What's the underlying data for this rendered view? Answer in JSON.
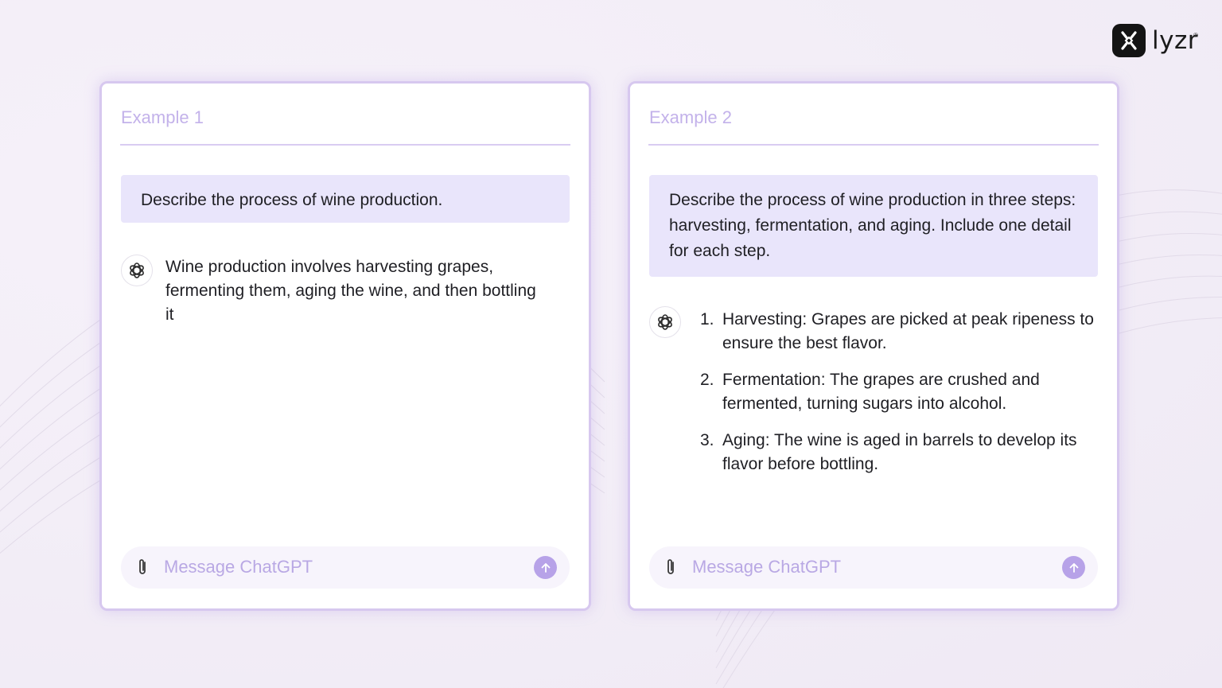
{
  "brand": {
    "name": "lyzr",
    "trademark": "®"
  },
  "examples": [
    {
      "title": "Example 1",
      "prompt": "Describe the process of wine production.",
      "reply": "Wine production involves harvesting grapes, fermenting them, aging the wine, and then bottling it",
      "composer": {
        "placeholder": "Message ChatGPT"
      }
    },
    {
      "title": "Example 2",
      "prompt": "Describe the process of wine production in three steps: harvesting, fermentation, and aging. Include one detail for each step.",
      "reply_items": [
        {
          "num": "1.",
          "text": "Harvesting: Grapes are picked at peak ripeness to ensure the best flavor."
        },
        {
          "num": "2.",
          "text": "Fermentation: The grapes are crushed and fermented, turning sugars into alcohol."
        },
        {
          "num": "3.",
          "text": "Aging: The wine is aged in barrels to develop its flavor before bottling."
        }
      ],
      "composer": {
        "placeholder": "Message ChatGPT"
      }
    }
  ],
  "icons": {
    "logo": "lyzr-logo-icon",
    "assistant": "openai-icon",
    "attach": "paperclip-icon",
    "send": "arrow-up-icon"
  },
  "colors": {
    "card_border": "#d7c8ef",
    "title": "#c3b2ea",
    "prompt_bg": "#e9e5fb",
    "send_button": "#b7a2e8"
  }
}
